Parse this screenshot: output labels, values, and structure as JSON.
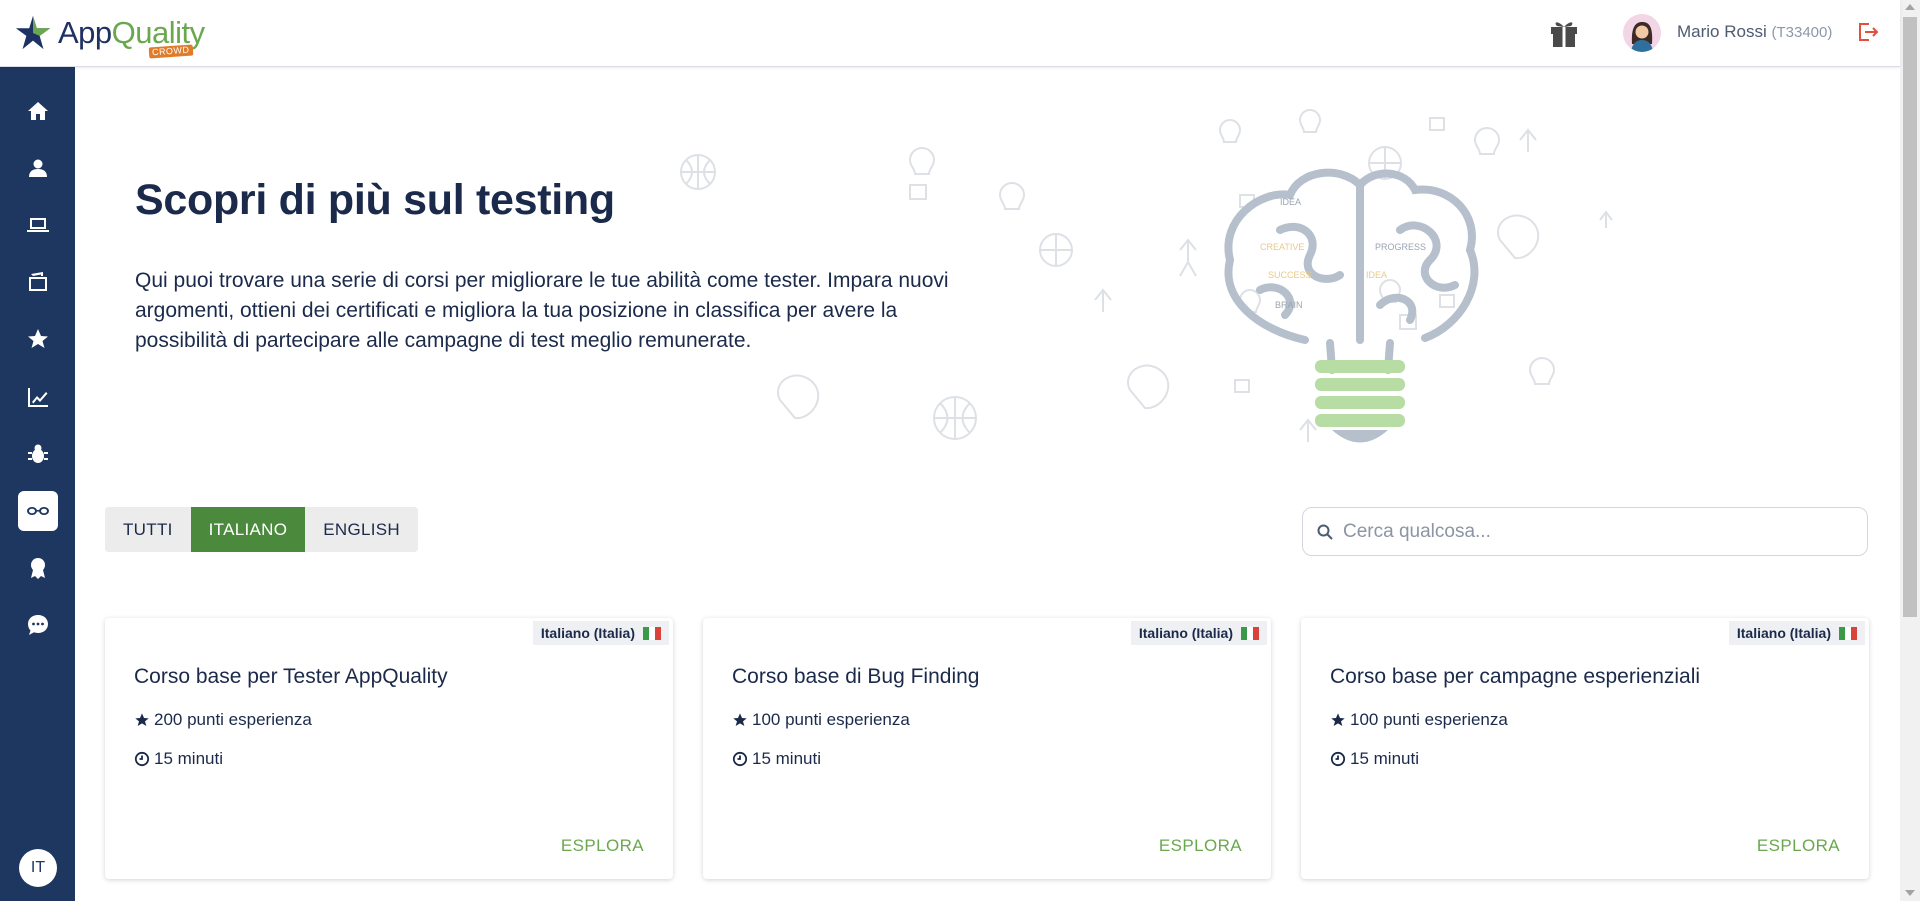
{
  "app": {
    "logo_primary": "App",
    "logo_secondary": "Quality",
    "logo_badge": "CROWD",
    "brand_color": "#1e3760",
    "accent_color": "#4b8a3c"
  },
  "header": {
    "user_name": "Mario Rossi",
    "user_code": "(T33400)",
    "gift_icon": "gift-icon",
    "logout_icon": "logout-icon"
  },
  "sidebar": {
    "items": [
      {
        "icon": "home-icon"
      },
      {
        "icon": "user-icon"
      },
      {
        "icon": "laptop-icon"
      },
      {
        "icon": "wallet-icon"
      },
      {
        "icon": "star-icon"
      },
      {
        "icon": "chart-icon"
      },
      {
        "icon": "bug-icon"
      },
      {
        "icon": "glasses-icon",
        "active": true
      },
      {
        "icon": "award-icon"
      },
      {
        "icon": "chat-icon"
      }
    ],
    "language": "IT"
  },
  "hero": {
    "title": "Scopri di più sul testing",
    "description": "Qui puoi trovare una serie di corsi per migliorare le tue abilità come tester. Impara nuovi argomenti, ottieni dei certificati e migliora la tua posizione in classifica per avere la possibilità di partecipare alle campagne di test meglio remunerate.",
    "art_words": [
      "IDEA",
      "CREATIVE",
      "PROGRESS",
      "SUCCESS",
      "IDEA",
      "BRAIN"
    ]
  },
  "filters": {
    "options": [
      "TUTTI",
      "ITALIANO",
      "ENGLISH"
    ],
    "selected": "ITALIANO"
  },
  "search": {
    "placeholder": "Cerca qualcosa...",
    "value": ""
  },
  "courses": [
    {
      "language": "Italiano (Italia)",
      "title": "Corso base per Tester AppQuality",
      "points": "200 punti esperienza",
      "duration": "15 minuti",
      "cta": "ESPLORA"
    },
    {
      "language": "Italiano (Italia)",
      "title": "Corso base di Bug Finding",
      "points": "100 punti esperienza",
      "duration": "15 minuti",
      "cta": "ESPLORA"
    },
    {
      "language": "Italiano (Italia)",
      "title": "Corso base per campagne esperienziali",
      "points": "100 punti esperienza",
      "duration": "15 minuti",
      "cta": "ESPLORA"
    }
  ]
}
